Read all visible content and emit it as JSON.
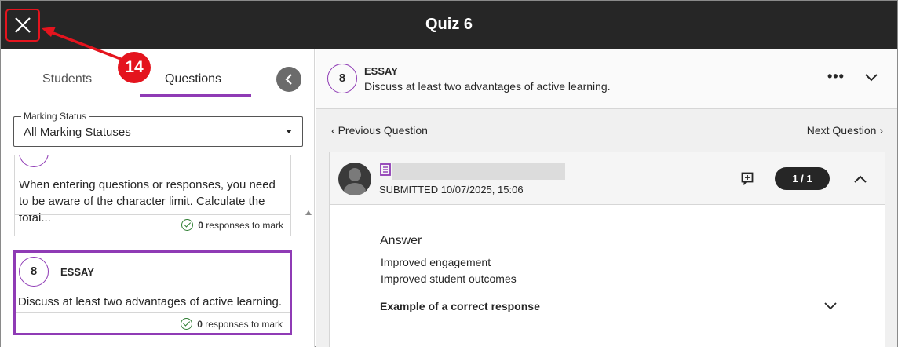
{
  "header": {
    "title": "Quiz 6",
    "close_icon": "close-icon"
  },
  "annotation": {
    "badge": "14",
    "color": "#e4141e"
  },
  "left_panel": {
    "tabs": [
      {
        "label": "Students",
        "active": false
      },
      {
        "label": "Questions",
        "active": true
      }
    ],
    "accent": "#8f3bb5",
    "back_icon": "chevron-left-icon",
    "filter": {
      "legend": "Marking Status",
      "value": "All Marking Statuses"
    },
    "cards": [
      {
        "text": "When entering questions or responses, you need to be aware of the character limit. Calculate the total...",
        "mark_count": "0",
        "mark_suffix": " responses to mark"
      },
      {
        "number": "8",
        "type": "ESSAY",
        "text": "Discuss at least two advantages of active learning.",
        "mark_count": "0",
        "mark_suffix": " responses to mark",
        "selected": true
      }
    ]
  },
  "question": {
    "number": "8",
    "type": "ESSAY",
    "prompt": "Discuss at least two advantages of active learning.",
    "more_label": "•••"
  },
  "navigation": {
    "prev": "Previous Question",
    "next": "Next Question"
  },
  "response": {
    "submitted": "SUBMITTED 10/07/2025, 15:06",
    "pager": "1 / 1",
    "answer_heading": "Answer",
    "answer_lines": [
      "Improved engagement",
      "Improved student outcomes"
    ],
    "correct_label": "Example of a correct response"
  }
}
